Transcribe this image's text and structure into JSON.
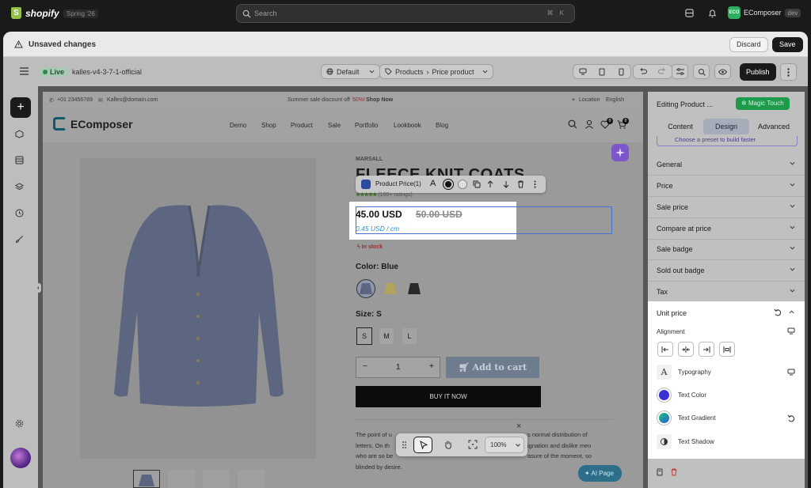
{
  "shopify": {
    "logo_text": "shopify",
    "season_badge": "Spring '26",
    "search_placeholder": "Search",
    "search_shortcut": "⌘ K",
    "store_initials": "ECO",
    "store_name": "EComposer",
    "store_env": "dev"
  },
  "save_bar": {
    "label": "Unsaved changes",
    "discard": "Discard",
    "save": "Save"
  },
  "editor_toolbar": {
    "status": "Live",
    "theme_name": "kalles-v4-3-7-1-official",
    "template_select": "Default",
    "breadcrumb_root": "Products",
    "breadcrumb_sep": "›",
    "breadcrumb_page": "Price product",
    "publish": "Publish"
  },
  "announcement": {
    "phone": "+01 23456789",
    "email": "Kalles@domain.com",
    "promo_prefix": "Summer sale discount off",
    "promo_pct": "50%!",
    "promo_link": "Shop Now",
    "location": "Location",
    "language": "English"
  },
  "store_header": {
    "brand": "EComposer",
    "nav": [
      "Demo",
      "Shop",
      "Product",
      "Sale",
      "Portfolio",
      "Lookbook",
      "Blog"
    ],
    "wishlist_count": "0",
    "cart_count": "0"
  },
  "product": {
    "vendor": "MARSALL",
    "title": "FLEECE KNIT COATS",
    "rating_stars": "★★★★★",
    "rating_text": "(100+ ratings)",
    "price": "45.00 USD",
    "compare_price": "50.00 USD",
    "unit_price": "0.45 USD / cm",
    "stock": "In stock",
    "color_label": "Color:",
    "color_value": "Blue",
    "size_label": "Size:",
    "size_value": "S",
    "sizes": [
      "S",
      "M",
      "L"
    ],
    "qty_minus": "−",
    "qty": "1",
    "qty_plus": "+",
    "add_to_cart": "Add to cart",
    "buy_now": "BUY IT NOW",
    "description_lines": [
      "The point of u",
      "letters. On th",
      "who are so be",
      "blinded by desire."
    ],
    "description_right": [
      "s normal distribution of",
      "ignation and dislike men",
      "asure of the moment, so",
      ""
    ]
  },
  "element_toolbar": {
    "label": "Product Price(1)"
  },
  "canvas_controls": {
    "zoom": "100%",
    "close": "×"
  },
  "ai_page": "AI Page",
  "right_panel": {
    "title": "Editing Product ...",
    "magic_touch": "Magic Touch",
    "tabs": [
      "Content",
      "Design",
      "Advanced"
    ],
    "active_tab": "Design",
    "preset_hint": "Choose a preset to build faster",
    "sections": [
      "General",
      "Price",
      "Sale price",
      "Compare at price",
      "Sale badge",
      "Sold out badge",
      "Tax"
    ],
    "unit_price": {
      "title": "Unit price",
      "alignment_label": "Alignment",
      "typography": "Typography",
      "text_color": "Text Color",
      "text_gradient": "Text Gradient",
      "text_shadow": "Text Shadow"
    }
  },
  "colors": {
    "accent_green": "#1e9a4b",
    "selection_blue": "#4a6fd6",
    "unit_price_color": "#2e8bc9",
    "text_color_swatch": "#3b2fd6"
  }
}
